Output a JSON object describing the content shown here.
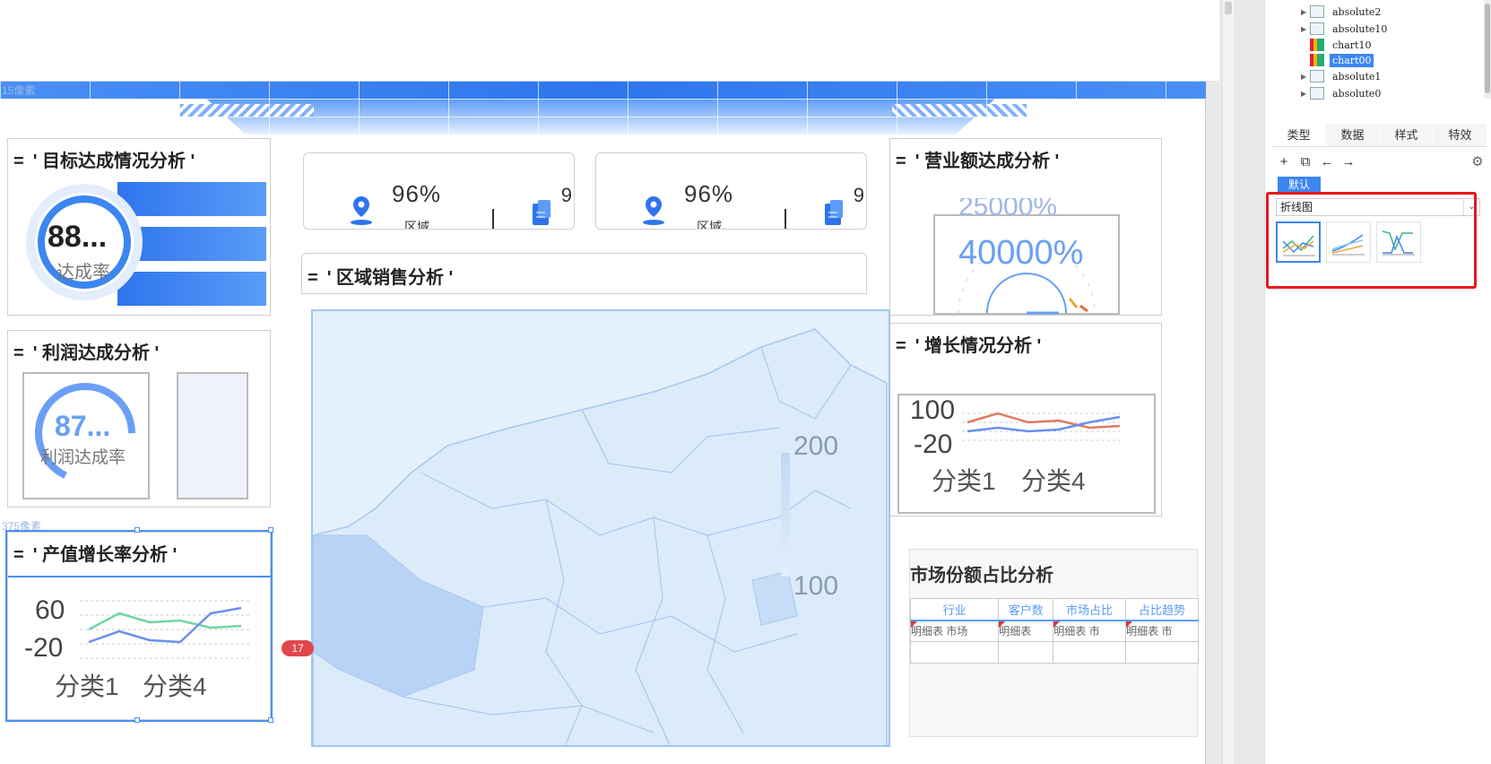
{
  "canvas": {
    "px_label_top": "15像素",
    "px_label_mid": "375像素",
    "badge": "17"
  },
  "panels": {
    "target": {
      "eq": "=",
      "title": "' 目标达成情况分析 '",
      "ring_value": "88...",
      "ring_label": "达成率"
    },
    "profit": {
      "eq": "=",
      "title": "' 利润达成分析 '",
      "ring_value": "87...",
      "ring_label": "利润达成率"
    },
    "output": {
      "eq": "=",
      "title": "' 产值增长率分析 '",
      "y_top": "60",
      "y_bottom": "-20",
      "cat1": "分类1",
      "cat2": "分类4"
    },
    "region": {
      "eq": "=",
      "title": "' 区域销售分析 '",
      "legend_top": "200",
      "legend_bottom": "100"
    },
    "revenue": {
      "eq": "=",
      "title": "' 营业额达成分析 '",
      "value_ghost": "25000%",
      "value": "40000%"
    },
    "growth": {
      "eq": "=",
      "title": "' 增长情况分析 '",
      "y_top": "100",
      "y_bottom": "-20",
      "cat1": "分类1",
      "cat2": "分类4"
    }
  },
  "kpi_cards": [
    {
      "value": "96%",
      "label": "区域",
      "tail": "9"
    },
    {
      "value": "96%",
      "label": "区域",
      "tail": "9"
    }
  ],
  "market": {
    "title": "市场份额占比分析",
    "headers": [
      "行业",
      "客户数",
      "市场占比",
      "占比趋势"
    ],
    "row": [
      "明细表",
      "明细表",
      "明细表",
      "明细表"
    ],
    "row_extra": [
      "市场",
      "",
      "市",
      "市"
    ]
  },
  "tree": [
    {
      "label": "absolute2",
      "type": "absolute",
      "expandable": true,
      "selected": false
    },
    {
      "label": "absolute10",
      "type": "absolute",
      "expandable": true,
      "selected": false
    },
    {
      "label": "chart10",
      "type": "chart",
      "expandable": false,
      "selected": false
    },
    {
      "label": "chart00",
      "type": "chart",
      "expandable": false,
      "selected": true
    },
    {
      "label": "absolute1",
      "type": "absolute",
      "expandable": true,
      "selected": false
    },
    {
      "label": "absolute0",
      "type": "absolute",
      "expandable": true,
      "selected": false
    }
  ],
  "right_pane": {
    "tabs": [
      "类型",
      "数据",
      "样式",
      "特效"
    ],
    "tools": [
      "+",
      "⧉",
      "←",
      "→"
    ],
    "subtab": "默认",
    "chart_type": "折线图",
    "chevron": "⌄"
  },
  "colors": {
    "accent": "#3b86f1",
    "highlight_red": "#e8171b",
    "series_blue": "#6a8ff0",
    "series_green": "#6fd5a5",
    "series_red": "#e07a5f"
  }
}
